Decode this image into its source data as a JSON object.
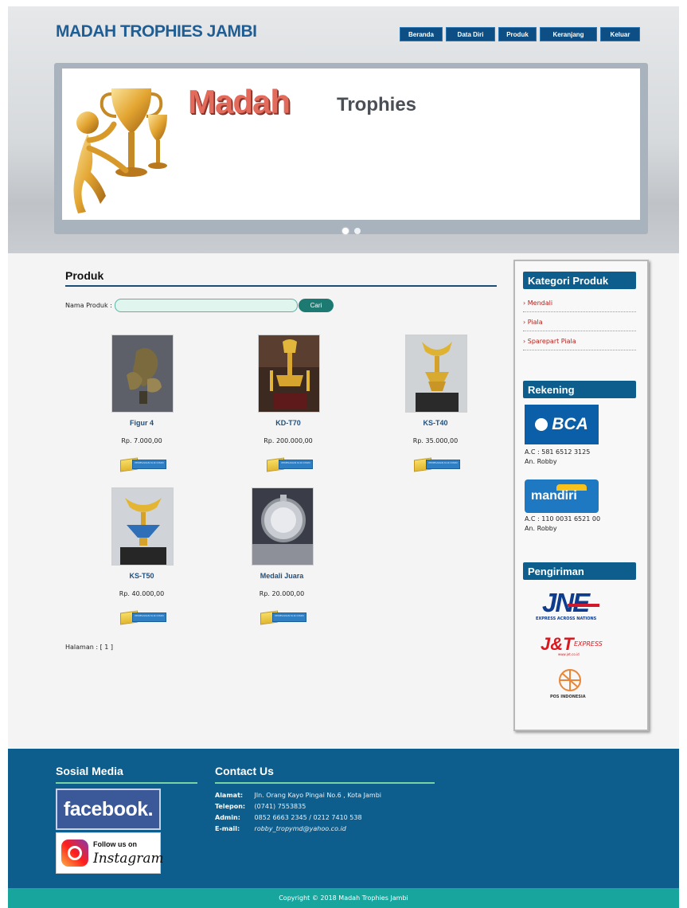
{
  "header": {
    "site_title": "MADAH TROPHIES JAMBI",
    "nav": [
      "Beranda",
      "Data Diri",
      "Produk",
      "Keranjang",
      "Keluar"
    ]
  },
  "banner": {
    "brand_word": "Madah",
    "brand_suffix": "Trophies"
  },
  "main": {
    "title": "Produk",
    "search": {
      "label": "Nama Produk :",
      "value": "",
      "button": "Cari"
    },
    "products": [
      {
        "name": "Figur 4",
        "price": "Rp. 7.000,00"
      },
      {
        "name": "KD-T70",
        "price": "Rp. 200.000,00"
      },
      {
        "name": "KS-T40",
        "price": "Rp. 35.000,00"
      },
      {
        "name": "KS-T50",
        "price": "Rp. 40.000,00"
      },
      {
        "name": "Medali Juara",
        "price": "Rp. 20.000,00"
      }
    ],
    "order_button": "PEMESANAN KLIK DISINI",
    "paging": "Halaman : [ 1 ]"
  },
  "sidebar": {
    "category_title": "Kategori Produk",
    "categories": [
      "› Mendali",
      "› Piala",
      "› Sparepart Piala"
    ],
    "rekening_title": "Rekening",
    "banks": [
      {
        "logo": "BCA",
        "account": "A.C : 581 6512 3125",
        "owner": "An. Robby"
      },
      {
        "logo": "mandiri",
        "account": "A.C : 110 0031 6521 00",
        "owner": "An. Robby"
      }
    ],
    "shipping_title": "Pengiriman",
    "couriers": {
      "jne": "JNE",
      "jne_tagline": "EXPRESS ACROSS NATIONS",
      "jnt": "J&T",
      "jnt_suffix": "EXPRESS",
      "jnt_site": "www.jet.co.id",
      "pos": "POS INDONESIA"
    }
  },
  "footer": {
    "social_title": "Sosial Media",
    "facebook": "facebook.",
    "instagram_follow": "Follow us on",
    "instagram_name": "Instagram",
    "contact_title": "Contact Us",
    "contacts": [
      {
        "label": "Alamat:",
        "value": "Jln. Orang Kayo Pingai No.6 , Kota Jambi"
      },
      {
        "label": "Telepon:",
        "value": "(0741) 7553835"
      },
      {
        "label": "Admin:",
        "value": "0852 6663 2345 / 0212 7410 538"
      },
      {
        "label": "E-mail:",
        "value": "robby_tropymd@yahoo.co.id"
      }
    ],
    "copyright": "Copyright © 2018 Madah Trophies Jambi"
  },
  "colors": {
    "nav_bg": "#0d4f85",
    "title_blue": "#1f5e94",
    "footer_bg": "#0d5e8c",
    "copyright_bg": "#17a59d",
    "search_btn": "#1d7a72",
    "category_red": "#b5231d"
  }
}
